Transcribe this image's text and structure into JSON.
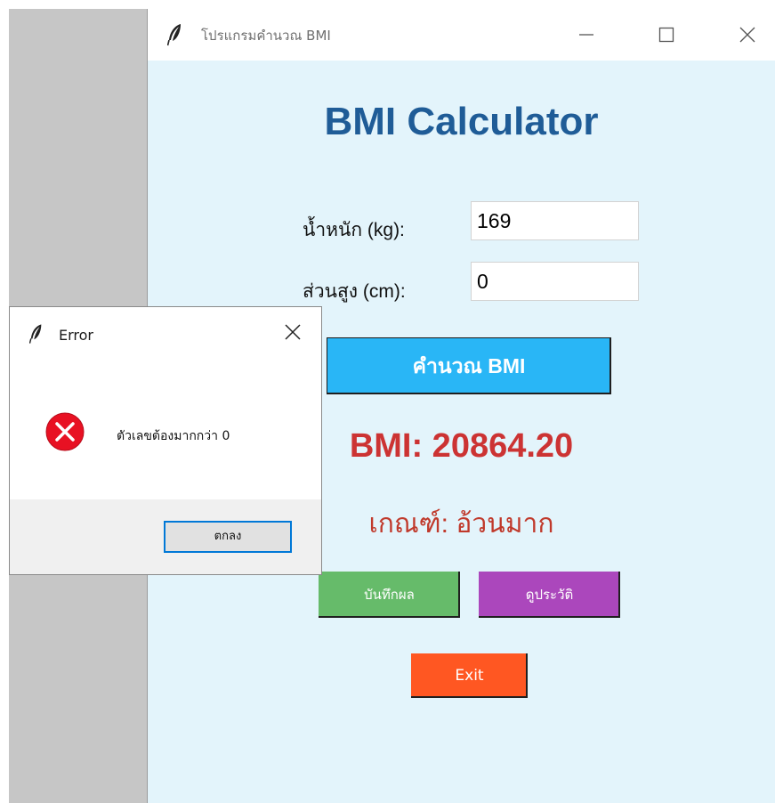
{
  "window": {
    "title": "โปรแกรมคำนวณ BMI"
  },
  "app": {
    "heading": "BMI Calculator",
    "weight_label": "น้ำหนัก (kg):",
    "weight_value": "169",
    "height_label": "ส่วนสูง (cm):",
    "height_value": "0",
    "calculate_label": "คำนวณ BMI",
    "bmi_result": "BMI: 20864.20",
    "category_result": "เกณฑ์: อ้วนมาก",
    "save_label": "บันทึกผล",
    "history_label": "ดูประวัติ",
    "exit_label": "Exit"
  },
  "dialog": {
    "title": "Error",
    "message": "ตัวเลขต้องมากกว่า 0",
    "ok_label": "ตกลง"
  },
  "colors": {
    "calculate_button": "#29b6f6",
    "save_button": "#66bb6a",
    "history_button": "#ab47bc",
    "exit_button": "#ff5722",
    "result_text": "#cc3333",
    "heading_text": "#1f5c97",
    "background": "#e3f4fb"
  },
  "icons": {
    "app_icon": "feather-icon",
    "error_icon": "error-circle-x-icon"
  }
}
